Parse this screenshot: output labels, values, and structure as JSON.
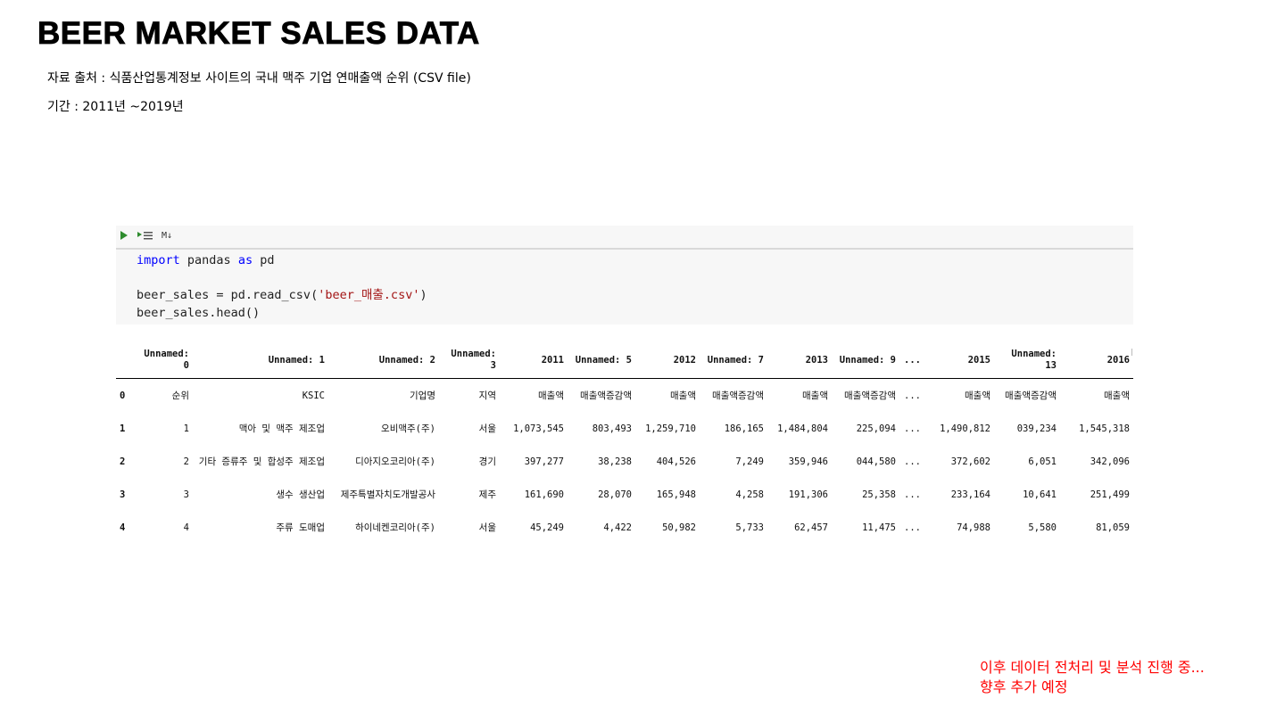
{
  "page": {
    "title": "BEER MARKET SALES DATA",
    "source_line": "자료 출처 : 식품산업통계정보 사이트의 국내 맥주 기업 연매출액 순위 (CSV file)",
    "period_line": "기간 : 2011년 ~2019년"
  },
  "cell": {
    "md_badge": "M↓",
    "code": {
      "l1_kw": "import",
      "l1_a": " pandas ",
      "l1_kw2": "as",
      "l1_b": " pd",
      "l3_a": "beer_sales = pd.read_csv(",
      "l3_str": "'beer_매출.csv'",
      "l3_b": ")",
      "l4": "beer_sales.head()"
    }
  },
  "table": {
    "columns": [
      "",
      "Unnamed: 0",
      "Unnamed: 1",
      "Unnamed: 2",
      "Unnamed: 3",
      "2011",
      "Unnamed: 5",
      "2012",
      "Unnamed: 7",
      "2013",
      "Unnamed: 9",
      "...",
      "2015",
      "Unnamed: 13",
      "2016"
    ],
    "rows": [
      [
        "0",
        "순위",
        "KSIC",
        "기업명",
        "지역",
        "매출액",
        "매출액증감액",
        "매출액",
        "매출액증감액",
        "매출액",
        "매출액증감액",
        "...",
        "매출액",
        "매출액증감액",
        "매출액"
      ],
      [
        "1",
        "1",
        "맥아 및 맥주 제조업",
        "오비맥주(주)",
        "서울",
        "1,073,545",
        "803,493",
        "1,259,710",
        "186,165",
        "1,484,804",
        "225,094",
        "...",
        "1,490,812",
        "039,234",
        "1,545,318"
      ],
      [
        "2",
        "2",
        "기타 증류주 및 합성주 제조업",
        "디아지오코리아(주)",
        "경기",
        "397,277",
        "38,238",
        "404,526",
        "7,249",
        "359,946",
        "044,580",
        "...",
        "372,602",
        "6,051",
        "342,096"
      ],
      [
        "3",
        "3",
        "생수 생산업",
        "제주특별자치도개발공사",
        "제주",
        "161,690",
        "28,070",
        "165,948",
        "4,258",
        "191,306",
        "25,358",
        "...",
        "233,164",
        "10,641",
        "251,499"
      ],
      [
        "4",
        "4",
        "주류 도매업",
        "하이네켄코리아(주)",
        "서울",
        "45,249",
        "4,422",
        "50,982",
        "5,733",
        "62,457",
        "11,475",
        "...",
        "74,988",
        "5,580",
        "81,059"
      ]
    ]
  },
  "note": {
    "line1": "이후 데이터 전처리 및 분석 진행 중...",
    "line2": "향후 추가 예정"
  }
}
